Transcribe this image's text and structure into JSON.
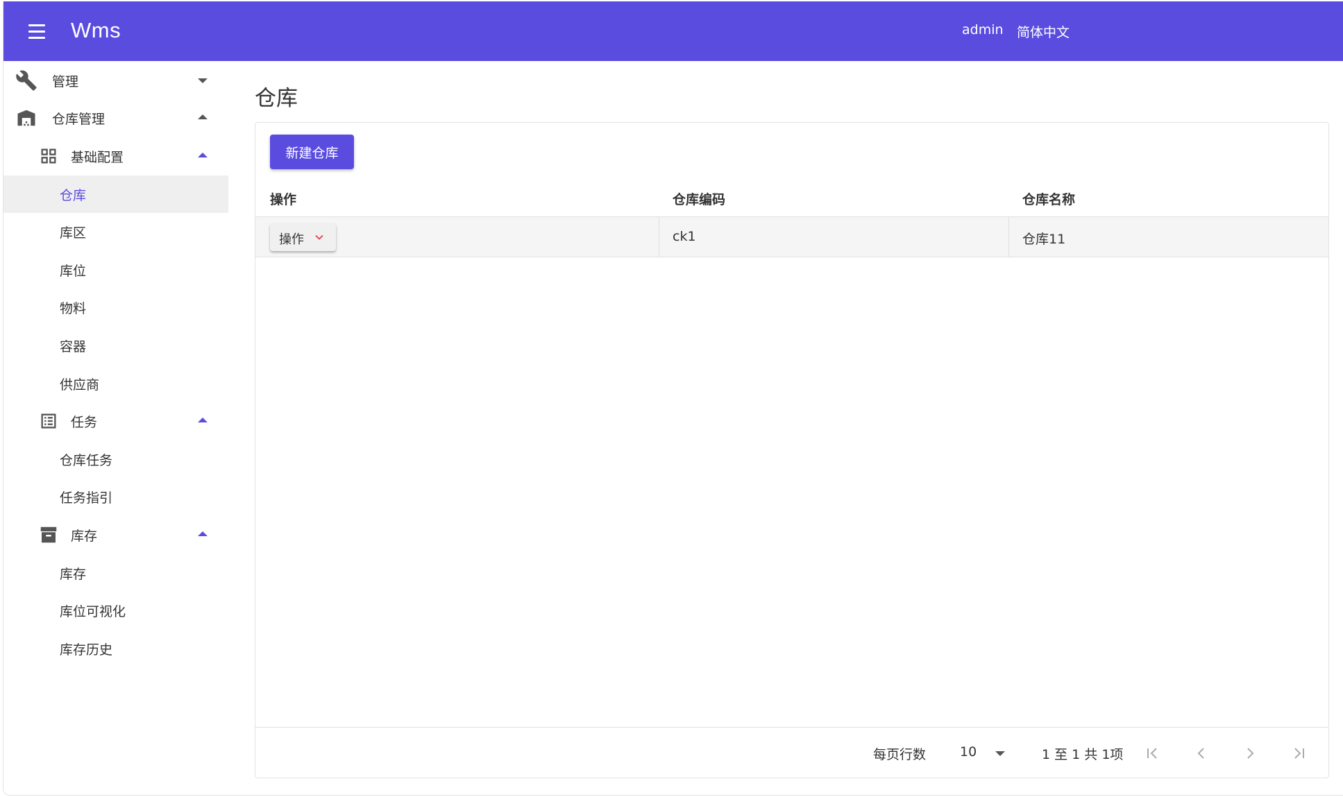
{
  "app": {
    "title": "Wms",
    "user": "admin",
    "language": "简体中文",
    "accent_color": "#5b4ce0"
  },
  "sidebar": {
    "items": [
      {
        "label": "管理",
        "icon": "wrench-icon",
        "expanded": false
      },
      {
        "label": "仓库管理",
        "icon": "warehouse-icon",
        "expanded": true
      },
      {
        "label": "基础配置",
        "icon": "grid-icon",
        "expanded": true
      },
      {
        "label": "仓库",
        "active": true
      },
      {
        "label": "库区"
      },
      {
        "label": "库位"
      },
      {
        "label": "物料"
      },
      {
        "label": "容器"
      },
      {
        "label": "供应商"
      },
      {
        "label": "任务",
        "icon": "list-icon",
        "expanded": true
      },
      {
        "label": "仓库任务"
      },
      {
        "label": "任务指引"
      },
      {
        "label": "库存",
        "icon": "archive-icon",
        "expanded": true
      },
      {
        "label": "库存"
      },
      {
        "label": "库位可视化"
      },
      {
        "label": "库存历史"
      }
    ]
  },
  "main": {
    "page_title": "仓库",
    "new_button": "新建仓库",
    "table": {
      "columns": [
        "操作",
        "仓库编码",
        "仓库名称"
      ],
      "rows": [
        {
          "action": "操作",
          "code": "ck1",
          "name": "仓库11"
        }
      ]
    },
    "pagination": {
      "rows_per_page_label": "每页行数",
      "rows_per_page": "10",
      "range_text": "1 至 1 共 1项"
    }
  }
}
